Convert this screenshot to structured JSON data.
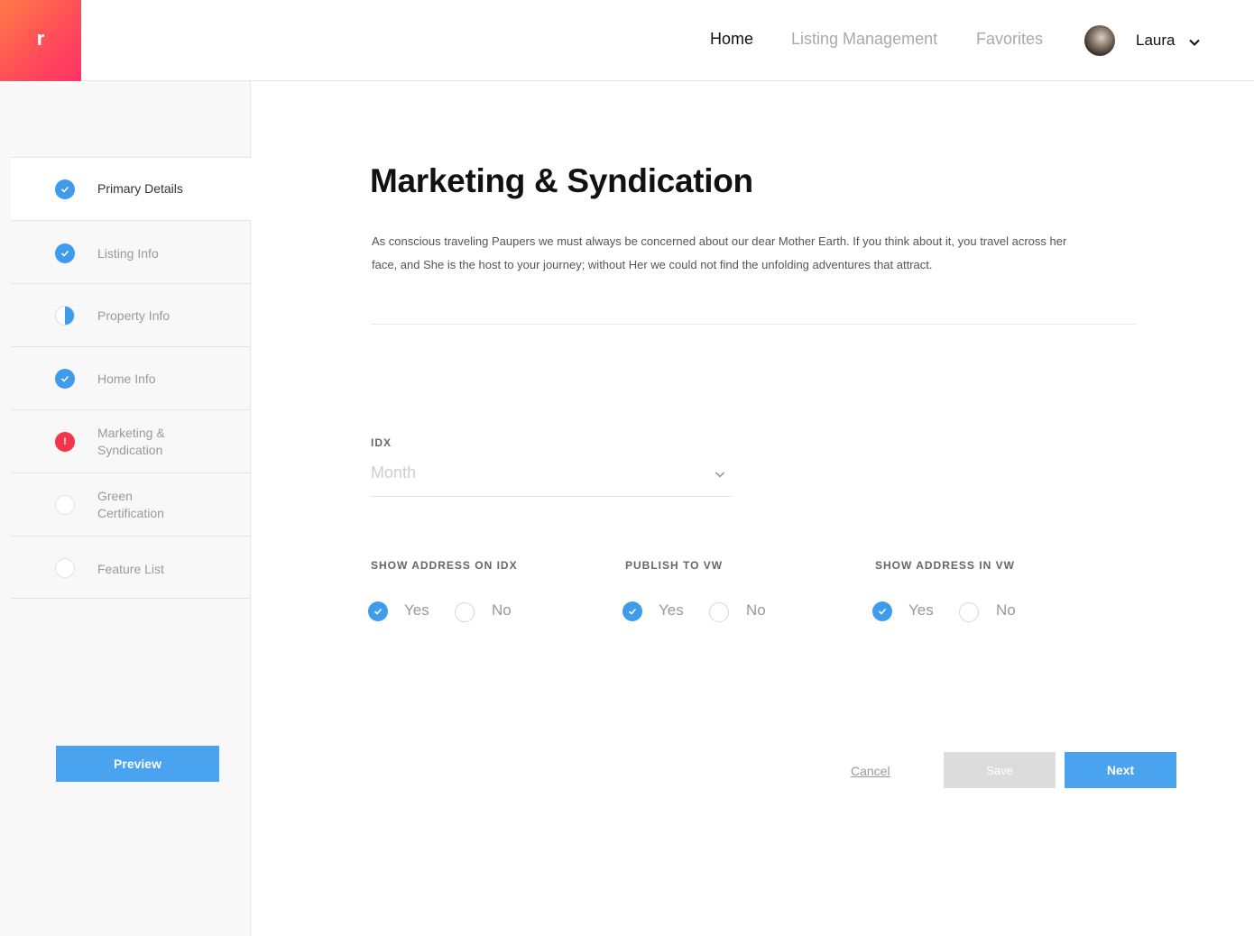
{
  "header": {
    "logo_letter": "r",
    "nav": [
      {
        "label": "Home",
        "active": true
      },
      {
        "label": "Listing Management",
        "active": false
      },
      {
        "label": "Favorites",
        "active": false
      }
    ],
    "user": {
      "name": "Laura"
    }
  },
  "sidebar": {
    "items": [
      {
        "label": "Primary Details",
        "status": "complete"
      },
      {
        "label": "Listing Info",
        "status": "complete"
      },
      {
        "label": "Property Info",
        "status": "partial"
      },
      {
        "label": "Home Info",
        "status": "complete"
      },
      {
        "label": "Marketing & Syndication",
        "status": "error",
        "badge": "!"
      },
      {
        "label": "Green Certification",
        "status": "empty"
      },
      {
        "label": "Feature List",
        "status": "empty"
      }
    ],
    "preview_label": "Preview"
  },
  "main": {
    "title": "Marketing & Syndication",
    "intro": "As conscious traveling Paupers we must always be concerned about our dear Mother Earth. If you think about it, you travel across her face, and She is the host to your journey; without Her we could not find the unfolding adventures that attract.",
    "idx": {
      "label": "IDX",
      "placeholder": "Month"
    },
    "radio_groups": [
      {
        "label": "SHOW ADDRESS ON IDX",
        "yes": "Yes",
        "no": "No",
        "selected": "Yes"
      },
      {
        "label": "PUBLISH TO VW",
        "yes": "Yes",
        "no": "No",
        "selected": "Yes"
      },
      {
        "label": "SHOW ADDRESS IN VW",
        "yes": "Yes",
        "no": "No",
        "selected": "Yes"
      }
    ],
    "actions": {
      "cancel": "Cancel",
      "save": "Save",
      "next": "Next"
    }
  },
  "colors": {
    "accent": "#3f9cec",
    "error": "#f4364c",
    "logo_start": "#ff7a45",
    "logo_end": "#ff3366"
  }
}
